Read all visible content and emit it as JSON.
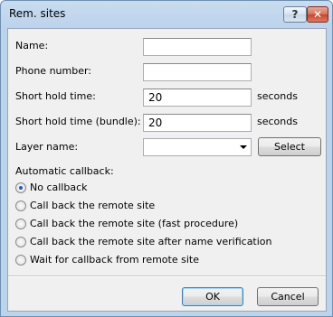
{
  "window": {
    "title": "Rem. sites",
    "help_label": "?",
    "close_label": "✕"
  },
  "form": {
    "name": {
      "label": "Name:",
      "value": ""
    },
    "phone": {
      "label": "Phone number:",
      "value": ""
    },
    "short_hold": {
      "label": "Short hold time:",
      "value": "20",
      "unit": "seconds"
    },
    "short_hold_bundle": {
      "label": "Short hold time (bundle):",
      "value": "20",
      "unit": "seconds"
    },
    "layer": {
      "label": "Layer name:",
      "value": "",
      "select_button": "Select"
    }
  },
  "callback": {
    "heading": "Automatic callback:",
    "options": [
      {
        "label": "No callback",
        "checked": true
      },
      {
        "label": "Call back the remote site",
        "checked": false
      },
      {
        "label": "Call back the remote site (fast procedure)",
        "checked": false
      },
      {
        "label": "Call back the remote site after name verification",
        "checked": false
      },
      {
        "label": "Wait for callback from remote site",
        "checked": false
      }
    ]
  },
  "footer": {
    "ok_label": "OK",
    "cancel_label": "Cancel"
  }
}
